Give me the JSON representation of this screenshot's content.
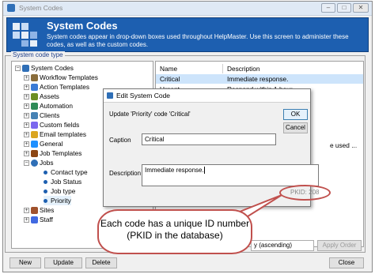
{
  "window": {
    "title": "System Codes"
  },
  "header": {
    "title": "System Codes",
    "description": "System codes appear in drop-down boxes used throughout HelpMaster.  Use this screen to administer these codes, as well as the custom codes."
  },
  "group_label": "System code type",
  "tree": {
    "root": "System Codes",
    "items": [
      {
        "label": "Workflow Templates",
        "color": "#8a6d3b"
      },
      {
        "label": "Action Templates",
        "color": "#3a7bd5"
      },
      {
        "label": "Assets",
        "color": "#6b8e23"
      },
      {
        "label": "Automation",
        "color": "#2e8b57"
      },
      {
        "label": "Clients",
        "color": "#4682b4"
      },
      {
        "label": "Custom fields",
        "color": "#7b68ee"
      },
      {
        "label": "Email templates",
        "color": "#daa520"
      },
      {
        "label": "General",
        "color": "#1e90ff"
      },
      {
        "label": "Job Templates",
        "color": "#8b4513"
      },
      {
        "label": "Jobs",
        "color": "#2f6fb7"
      }
    ],
    "job_children": [
      "Contact type",
      "Job Status",
      "Job type",
      "Priority"
    ],
    "after": [
      {
        "label": "Sites",
        "color": "#a0522d"
      },
      {
        "label": "Staff",
        "color": "#4169e1"
      }
    ]
  },
  "grid": {
    "columns": [
      "Name",
      "Description"
    ],
    "rows": [
      {
        "name": "Critical",
        "description": "Immediate response."
      },
      {
        "name": "Urgent",
        "description": "Respond within 1 hour"
      }
    ],
    "partial_text": "e used ...",
    "sort_label": "y (ascending)",
    "apply_order": "Apply Order"
  },
  "dialog": {
    "title": "Edit System Code",
    "subtitle": "Update 'Priority' code 'Critical'",
    "caption_label": "Caption",
    "caption_value": "Critical",
    "description_label": "Description",
    "description_value": "Immediate response.",
    "pkid": "PKID: 208",
    "ok": "OK",
    "cancel": "Cancel"
  },
  "callout": {
    "line1": "Each code has a unique ID number",
    "line2": "(PKID in the database)"
  },
  "buttons": {
    "new": "New",
    "update": "Update",
    "delete": "Delete",
    "close": "Close"
  },
  "colors": {
    "header_bg": "#1d5fb0",
    "callout_border": "#c0504d",
    "selected_row": "#cde4fb"
  }
}
